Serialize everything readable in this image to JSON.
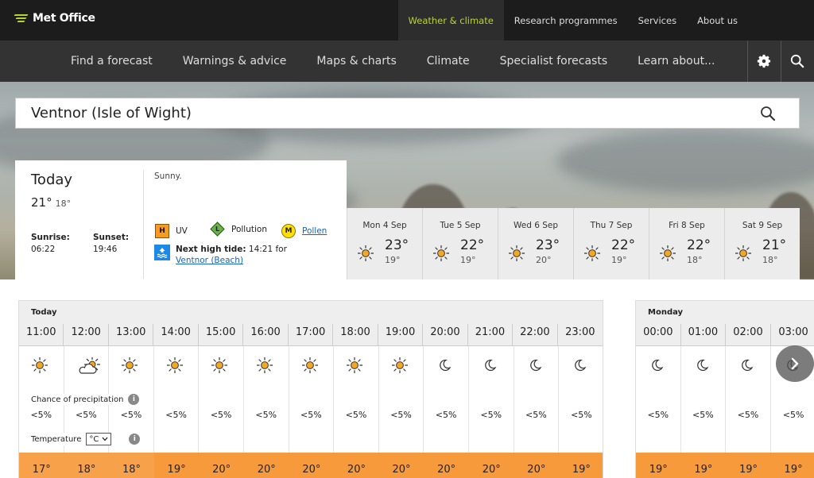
{
  "header": {
    "logo_text": "Met Office",
    "top_links": [
      "Weather & climate",
      "Research programmes",
      "Services",
      "About us"
    ],
    "active_top_link": "Weather & climate",
    "nav_links": [
      "Find a forecast",
      "Warnings & advice",
      "Maps & charts",
      "Climate",
      "Specialist forecasts",
      "Learn about..."
    ]
  },
  "search": {
    "location": "Ventnor (Isle of Wight)"
  },
  "today": {
    "title": "Today",
    "high": "21°",
    "low": "18°",
    "sunrise_label": "Sunrise:",
    "sunrise": "06:22",
    "sunset_label": "Sunset:",
    "sunset": "19:46",
    "summary": "Sunny.",
    "uv_badge": "H",
    "uv_label": "UV",
    "pollution_badge": "L",
    "pollution_label": "Pollution",
    "pollen_badge": "M",
    "pollen_label": "Pollen",
    "tide_label": "Next high tide:",
    "tide_time": "14:21 for",
    "tide_location": "Ventnor (Beach)"
  },
  "days": [
    {
      "name": "Mon 4 Sep",
      "high": "23°",
      "low": "19°"
    },
    {
      "name": "Tue 5 Sep",
      "high": "22°",
      "low": "19°"
    },
    {
      "name": "Wed 6 Sep",
      "high": "23°",
      "low": "20°"
    },
    {
      "name": "Thu 7 Sep",
      "high": "22°",
      "low": "19°"
    },
    {
      "name": "Fri 8 Sep",
      "high": "22°",
      "low": "18°"
    },
    {
      "name": "Sat 9 Sep",
      "high": "21°",
      "low": "18°"
    }
  ],
  "hourly": {
    "precip_label": "Chance of precipitation",
    "temp_label": "Temperature",
    "temp_unit": "°C",
    "panels": [
      {
        "title": "Today",
        "hours": [
          {
            "time": "11:00",
            "icon": "sun-icon",
            "precip": "<5%",
            "temp": "17°"
          },
          {
            "time": "12:00",
            "icon": "sun-cloud-icon",
            "precip": "<5%",
            "temp": "18°"
          },
          {
            "time": "13:00",
            "icon": "sun-icon",
            "precip": "<5%",
            "temp": "18°"
          },
          {
            "time": "14:00",
            "icon": "sun-icon",
            "precip": "<5%",
            "temp": "19°"
          },
          {
            "time": "15:00",
            "icon": "sun-icon",
            "precip": "<5%",
            "temp": "20°"
          },
          {
            "time": "16:00",
            "icon": "sun-icon",
            "precip": "<5%",
            "temp": "20°"
          },
          {
            "time": "17:00",
            "icon": "sun-icon",
            "precip": "<5%",
            "temp": "20°"
          },
          {
            "time": "18:00",
            "icon": "sun-icon",
            "precip": "<5%",
            "temp": "20°"
          },
          {
            "time": "19:00",
            "icon": "sun-icon",
            "precip": "<5%",
            "temp": "20°"
          },
          {
            "time": "20:00",
            "icon": "moon-icon",
            "precip": "<5%",
            "temp": "20°"
          },
          {
            "time": "21:00",
            "icon": "moon-icon",
            "precip": "<5%",
            "temp": "20°"
          },
          {
            "time": "22:00",
            "icon": "moon-icon",
            "precip": "<5%",
            "temp": "20°"
          },
          {
            "time": "23:00",
            "icon": "moon-icon",
            "precip": "<5%",
            "temp": "19°"
          }
        ]
      },
      {
        "title": "Monday",
        "hours": [
          {
            "time": "00:00",
            "icon": "moon-icon",
            "precip": "<5%",
            "temp": "19°"
          },
          {
            "time": "01:00",
            "icon": "moon-icon",
            "precip": "<5%",
            "temp": "19°"
          },
          {
            "time": "02:00",
            "icon": "moon-icon",
            "precip": "<5%",
            "temp": "19°"
          },
          {
            "time": "03:00",
            "icon": "moon-icon",
            "precip": "<5%",
            "temp": "19°"
          }
        ]
      }
    ]
  },
  "colors": {
    "accent": "#b8d432",
    "temp_warm": "#f7a24a",
    "temp_warmer": "#f79a3c",
    "sun": "#f5a623"
  }
}
